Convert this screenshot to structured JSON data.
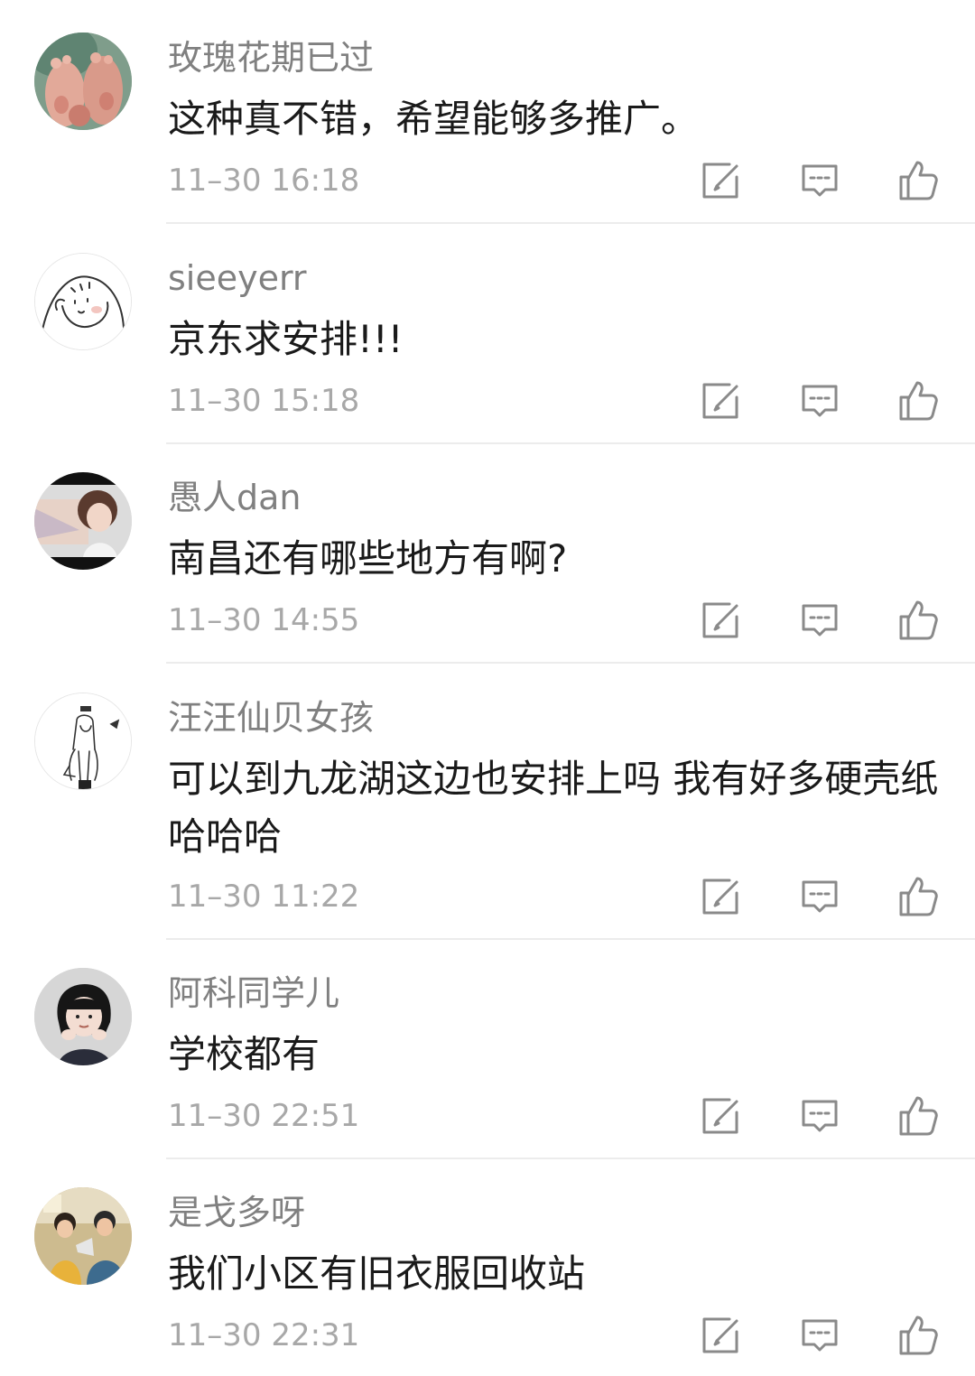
{
  "comments": [
    {
      "username": "玫瑰花期已过",
      "content": "这种真不错，希望能够多推广。",
      "time": "11–30 16:18",
      "avatar_icon": "baby-feet-avatar"
    },
    {
      "username": "sieeyerr",
      "content": "京东求安排!!!",
      "time": "11–30 15:18",
      "avatar_icon": "cartoon-face-avatar"
    },
    {
      "username": "愚人dan",
      "content": "南昌还有哪些地方有啊?",
      "time": "11–30 14:55",
      "avatar_icon": "girl-photo-avatar"
    },
    {
      "username": "汪汪仙贝女孩",
      "content": "可以到九龙湖这边也安排上吗 我有好多硬壳纸哈哈哈",
      "time": "11–30 11:22",
      "avatar_icon": "sketch-girl-avatar"
    },
    {
      "username": "阿科同学儿",
      "content": "学校都有",
      "time": "11–30 22:51",
      "avatar_icon": "child-photo-avatar"
    },
    {
      "username": "是戈多呀",
      "content": "我们小区有旧衣服回收站",
      "time": "11–30 22:31",
      "avatar_icon": "couple-photo-avatar"
    }
  ],
  "colors": {
    "username": "#808080",
    "content": "#1a1a1a",
    "time": "#a8a8a8",
    "icon": "#8a8a8a",
    "divider": "#ececec"
  }
}
